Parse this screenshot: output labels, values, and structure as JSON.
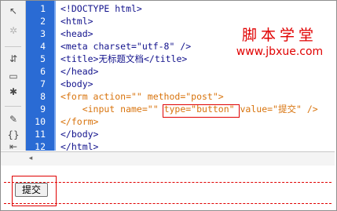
{
  "line_numbers": [
    "1",
    "2",
    "3",
    "4",
    "5",
    "6",
    "7",
    "8",
    "9",
    "10",
    "11",
    "12"
  ],
  "code_lines": [
    "<!DOCTYPE html>",
    "<html>",
    "<head>",
    "<meta charset=\"utf-8\" />",
    "<title>",
    "</head>",
    "<body>",
    "<form action=\"\" method=\"post\">",
    "    <input name=\"\" ",
    "</form>",
    "</body>",
    "</html>"
  ],
  "title_line": {
    "open": "<title>",
    "text": "无标题文档",
    "close": "</title>"
  },
  "input_line": {
    "prefix": "    <input name=\"\" ",
    "highlight": "type=\"button\"",
    "value_part": " value=\"",
    "value_text": "提交",
    "suffix": "\" />"
  },
  "watermark": {
    "line1": "脚本学堂",
    "line2": "www.jbxue.com"
  },
  "toolbar_icons": [
    "arrow-icon",
    "gear-icon",
    "tree-collapse-icon",
    "tree-expand-icon",
    "select-icon",
    "comment-icon",
    "braces-icon",
    "indent-icon"
  ],
  "design_view": {
    "button_label": "提交"
  },
  "colors": {
    "gutter": "#2a6bd4",
    "tag": "#12128c",
    "form_tag": "#d8730c",
    "highlight": "#e00000"
  }
}
